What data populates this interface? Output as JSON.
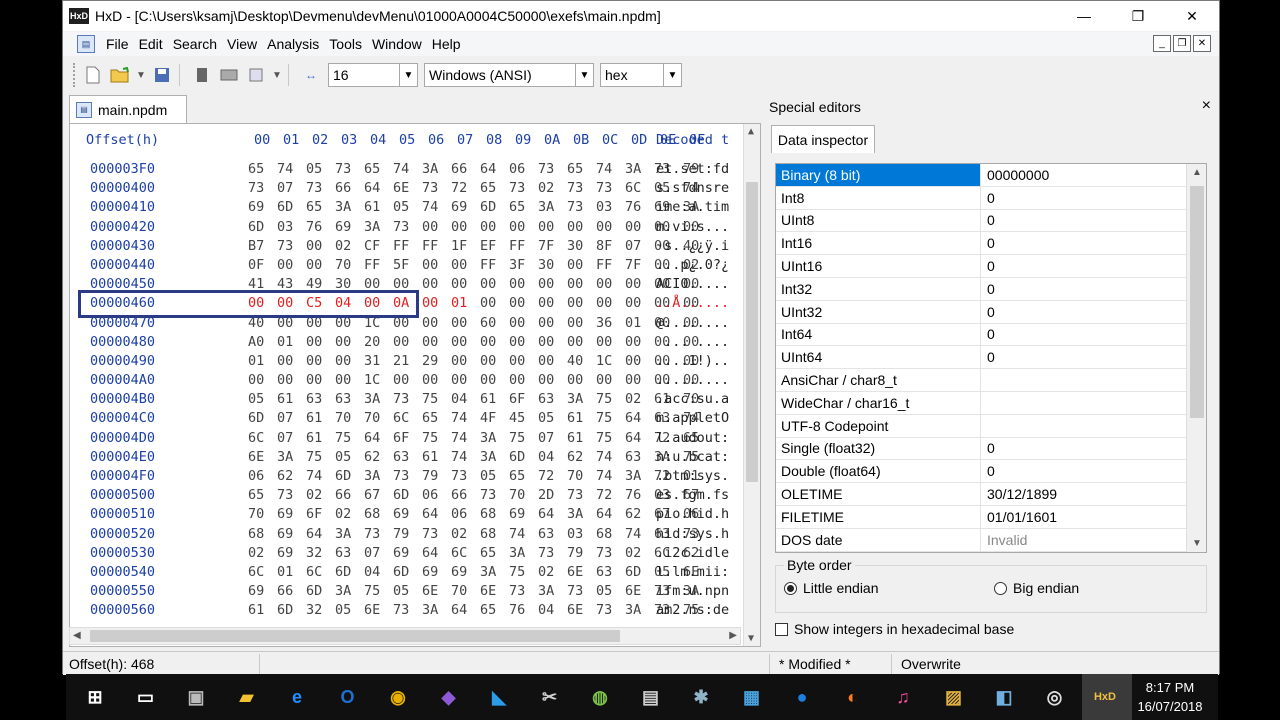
{
  "window": {
    "title": "HxD - [C:\\Users\\ksamj\\Desktop\\Devmenu\\devMenu\\01000A0004C50000\\exefs\\main.npdm]",
    "app_icon": "HxD",
    "minimize": "—",
    "maximize": "❐",
    "close": "✕"
  },
  "menu": {
    "items": [
      "File",
      "Edit",
      "Search",
      "View",
      "Analysis",
      "Tools",
      "Window",
      "Help"
    ],
    "mdi_min": "_",
    "mdi_restore": "❐",
    "mdi_close": "✕"
  },
  "toolbar": {
    "bytes_per_row": "16",
    "charset": "Windows (ANSI)",
    "offset_base": "hex"
  },
  "document": {
    "tab_label": "main.npdm",
    "header_offset": "Offset(h)",
    "columns": [
      "00",
      "01",
      "02",
      "03",
      "04",
      "05",
      "06",
      "07",
      "08",
      "09",
      "0A",
      "0B",
      "0C",
      "0D",
      "0E",
      "0F"
    ],
    "header_decoded": "Decoded t",
    "highlight_row": 7,
    "highlight_count": 8,
    "rows": [
      {
        "offset": "000003F0",
        "bytes": [
          "65",
          "74",
          "05",
          "73",
          "65",
          "74",
          "3A",
          "66",
          "64",
          "06",
          "73",
          "65",
          "74",
          "3A",
          "73",
          "79"
        ],
        "decoded": "et.set:fd"
      },
      {
        "offset": "00000400",
        "bytes": [
          "73",
          "07",
          "73",
          "66",
          "64",
          "6E",
          "73",
          "72",
          "65",
          "73",
          "02",
          "73",
          "73",
          "6C",
          "05",
          "74"
        ],
        "decoded": "s.sfdnsre"
      },
      {
        "offset": "00000410",
        "bytes": [
          "69",
          "6D",
          "65",
          "3A",
          "61",
          "05",
          "74",
          "69",
          "6D",
          "65",
          "3A",
          "73",
          "03",
          "76",
          "69",
          "3A"
        ],
        "decoded": "ime:a.tim"
      },
      {
        "offset": "00000420",
        "bytes": [
          "6D",
          "03",
          "76",
          "69",
          "3A",
          "73",
          "00",
          "00",
          "00",
          "00",
          "00",
          "00",
          "00",
          "00",
          "00",
          "00"
        ],
        "decoded": "m.vi:s..."
      },
      {
        "offset": "00000430",
        "bytes": [
          "B7",
          "73",
          "00",
          "02",
          "CF",
          "FF",
          "FF",
          "1F",
          "EF",
          "FF",
          "7F",
          "30",
          "8F",
          "07",
          "00",
          "40"
        ],
        "decoded": "·s..¿¿ÿ.i"
      },
      {
        "offset": "00000440",
        "bytes": [
          "0F",
          "00",
          "00",
          "70",
          "FF",
          "5F",
          "00",
          "00",
          "FF",
          "3F",
          "30",
          "00",
          "FF",
          "7F",
          "00",
          "02"
        ],
        "decoded": "...p¿.0?¿"
      },
      {
        "offset": "00000450",
        "bytes": [
          "41",
          "43",
          "49",
          "30",
          "00",
          "00",
          "00",
          "00",
          "00",
          "00",
          "00",
          "00",
          "00",
          "00",
          "00",
          "00"
        ],
        "decoded": "ACI0....."
      },
      {
        "offset": "00000460",
        "bytes": [
          "00",
          "00",
          "C5",
          "04",
          "00",
          "0A",
          "00",
          "01",
          "00",
          "00",
          "00",
          "00",
          "00",
          "00",
          "00",
          "00"
        ],
        "decoded": "..Å......"
      },
      {
        "offset": "00000470",
        "bytes": [
          "40",
          "00",
          "00",
          "00",
          "1C",
          "00",
          "00",
          "00",
          "60",
          "00",
          "00",
          "00",
          "36",
          "01",
          "00",
          "00"
        ],
        "decoded": "@........"
      },
      {
        "offset": "00000480",
        "bytes": [
          "A0",
          "01",
          "00",
          "00",
          "20",
          "00",
          "00",
          "00",
          "00",
          "00",
          "00",
          "00",
          "00",
          "00",
          "00",
          "00"
        ],
        "decoded": " ... ...."
      },
      {
        "offset": "00000490",
        "bytes": [
          "01",
          "00",
          "00",
          "00",
          "31",
          "21",
          "29",
          "00",
          "00",
          "00",
          "00",
          "40",
          "1C",
          "00",
          "00",
          "00"
        ],
        "decoded": "....1!).."
      },
      {
        "offset": "000004A0",
        "bytes": [
          "00",
          "00",
          "00",
          "00",
          "1C",
          "00",
          "00",
          "00",
          "00",
          "00",
          "00",
          "00",
          "00",
          "00",
          "00",
          "00"
        ],
        "decoded": "........."
      },
      {
        "offset": "000004B0",
        "bytes": [
          "05",
          "61",
          "63",
          "63",
          "3A",
          "73",
          "75",
          "04",
          "61",
          "6F",
          "63",
          "3A",
          "75",
          "02",
          "61",
          "70"
        ],
        "decoded": ".acc:su.a"
      },
      {
        "offset": "000004C0",
        "bytes": [
          "6D",
          "07",
          "61",
          "70",
          "70",
          "6C",
          "65",
          "74",
          "4F",
          "45",
          "05",
          "61",
          "75",
          "64",
          "63",
          "74"
        ],
        "decoded": "m.appletO"
      },
      {
        "offset": "000004D0",
        "bytes": [
          "6C",
          "07",
          "61",
          "75",
          "64",
          "6F",
          "75",
          "74",
          "3A",
          "75",
          "07",
          "61",
          "75",
          "64",
          "72",
          "65"
        ],
        "decoded": "l.audout:"
      },
      {
        "offset": "000004E0",
        "bytes": [
          "6E",
          "3A",
          "75",
          "05",
          "62",
          "63",
          "61",
          "74",
          "3A",
          "6D",
          "04",
          "62",
          "74",
          "63",
          "3A",
          "75"
        ],
        "decoded": "n:u.bcat:"
      },
      {
        "offset": "000004F0",
        "bytes": [
          "06",
          "62",
          "74",
          "6D",
          "3A",
          "73",
          "79",
          "73",
          "05",
          "65",
          "72",
          "70",
          "74",
          "3A",
          "72",
          "01"
        ],
        "decoded": ".btm:sys."
      },
      {
        "offset": "00000500",
        "bytes": [
          "65",
          "73",
          "02",
          "66",
          "67",
          "6D",
          "06",
          "66",
          "73",
          "70",
          "2D",
          "73",
          "72",
          "76",
          "03",
          "67"
        ],
        "decoded": "es.fgm.fs"
      },
      {
        "offset": "00000510",
        "bytes": [
          "70",
          "69",
          "6F",
          "02",
          "68",
          "69",
          "64",
          "06",
          "68",
          "69",
          "64",
          "3A",
          "64",
          "62",
          "67",
          "06"
        ],
        "decoded": "pio.hid.h"
      },
      {
        "offset": "00000520",
        "bytes": [
          "68",
          "69",
          "64",
          "3A",
          "73",
          "79",
          "73",
          "02",
          "68",
          "74",
          "63",
          "03",
          "68",
          "74",
          "63",
          "73"
        ],
        "decoded": "hid:sys.h"
      },
      {
        "offset": "00000530",
        "bytes": [
          "02",
          "69",
          "32",
          "63",
          "07",
          "69",
          "64",
          "6C",
          "65",
          "3A",
          "73",
          "79",
          "73",
          "02",
          "6C",
          "62"
        ],
        "decoded": ".i2c.idle"
      },
      {
        "offset": "00000540",
        "bytes": [
          "6C",
          "01",
          "6C",
          "6D",
          "04",
          "6D",
          "69",
          "69",
          "3A",
          "75",
          "02",
          "6E",
          "63",
          "6D",
          "05",
          "6E"
        ],
        "decoded": "l.lm.mii:"
      },
      {
        "offset": "00000550",
        "bytes": [
          "69",
          "66",
          "6D",
          "3A",
          "75",
          "05",
          "6E",
          "70",
          "6E",
          "73",
          "3A",
          "73",
          "05",
          "6E",
          "73",
          "3A"
        ],
        "decoded": "ifm:u.npn"
      },
      {
        "offset": "00000560",
        "bytes": [
          "61",
          "6D",
          "32",
          "05",
          "6E",
          "73",
          "3A",
          "64",
          "65",
          "76",
          "04",
          "6E",
          "73",
          "3A",
          "73",
          "75"
        ],
        "decoded": "am2.ns:de"
      }
    ]
  },
  "special_editors": {
    "title": "Special editors",
    "close": "×",
    "tab": "Data inspector",
    "rows": [
      {
        "name": "Binary (8 bit)",
        "value": "00000000",
        "selected": true
      },
      {
        "name": "Int8",
        "value": "0"
      },
      {
        "name": "UInt8",
        "value": "0"
      },
      {
        "name": "Int16",
        "value": "0"
      },
      {
        "name": "UInt16",
        "value": "0"
      },
      {
        "name": "Int32",
        "value": "0"
      },
      {
        "name": "UInt32",
        "value": "0"
      },
      {
        "name": "Int64",
        "value": "0"
      },
      {
        "name": "UInt64",
        "value": "0"
      },
      {
        "name": "AnsiChar / char8_t",
        "value": ""
      },
      {
        "name": "WideChar / char16_t",
        "value": ""
      },
      {
        "name": "UTF-8 Codepoint",
        "value": ""
      },
      {
        "name": "Single (float32)",
        "value": "0"
      },
      {
        "name": "Double (float64)",
        "value": "0"
      },
      {
        "name": "OLETIME",
        "value": "30/12/1899"
      },
      {
        "name": "FILETIME",
        "value": "01/01/1601"
      },
      {
        "name": "DOS date",
        "value": "Invalid",
        "muted": true
      }
    ],
    "byte_order_label": "Byte order",
    "little_endian": "Little endian",
    "big_endian": "Big endian",
    "hex_base_label": "Show integers in hexadecimal base"
  },
  "status": {
    "offset": "Offset(h): 468",
    "modified": "* Modified *",
    "mode": "Overwrite"
  },
  "taskbar": {
    "time": "8:17 PM",
    "date": "16/07/2018",
    "icons": [
      {
        "name": "start-icon",
        "glyph": "⊞",
        "color": "#ffffff"
      },
      {
        "name": "task-view-icon",
        "glyph": "▭",
        "color": "#ffffff"
      },
      {
        "name": "cmd-icon",
        "glyph": "▣",
        "color": "#bbbbbb"
      },
      {
        "name": "file-explorer-icon",
        "glyph": "▰",
        "color": "#f2c230"
      },
      {
        "name": "edge-icon",
        "glyph": "e",
        "color": "#1e90ff"
      },
      {
        "name": "outlook-icon",
        "glyph": "O",
        "color": "#1e6fd0"
      },
      {
        "name": "chrome-icon",
        "glyph": "◉",
        "color": "#e8b100"
      },
      {
        "name": "visual-studio-icon",
        "glyph": "◆",
        "color": "#8e5ad8"
      },
      {
        "name": "vscode-icon",
        "glyph": "◣",
        "color": "#2c9ce8"
      },
      {
        "name": "tools-icon",
        "glyph": "✂",
        "color": "#d0d0d0"
      },
      {
        "name": "android-studio-icon",
        "glyph": "◍",
        "color": "#7cc04a"
      },
      {
        "name": "remote-desktop-icon",
        "glyph": "▤",
        "color": "#d0d0d0"
      },
      {
        "name": "settings-app-icon",
        "glyph": "✱",
        "color": "#8fb4c8"
      },
      {
        "name": "monitor-app-icon",
        "glyph": "▦",
        "color": "#4aa3df"
      },
      {
        "name": "maps-icon",
        "glyph": "●",
        "color": "#1f7fe0"
      },
      {
        "name": "firefox-icon",
        "glyph": "◐",
        "color": "#ff7a1a"
      },
      {
        "name": "itunes-icon",
        "glyph": "♫",
        "color": "#f04a9a"
      },
      {
        "name": "app-icon-generic",
        "glyph": "▨",
        "color": "#e0b040"
      },
      {
        "name": "notes-app-icon",
        "glyph": "◧",
        "color": "#70b0e0"
      },
      {
        "name": "obs-icon",
        "glyph": "◎",
        "color": "#dddddd"
      },
      {
        "name": "hxd-taskbar-icon",
        "glyph": "HxD",
        "color": "#f0c040"
      }
    ]
  }
}
